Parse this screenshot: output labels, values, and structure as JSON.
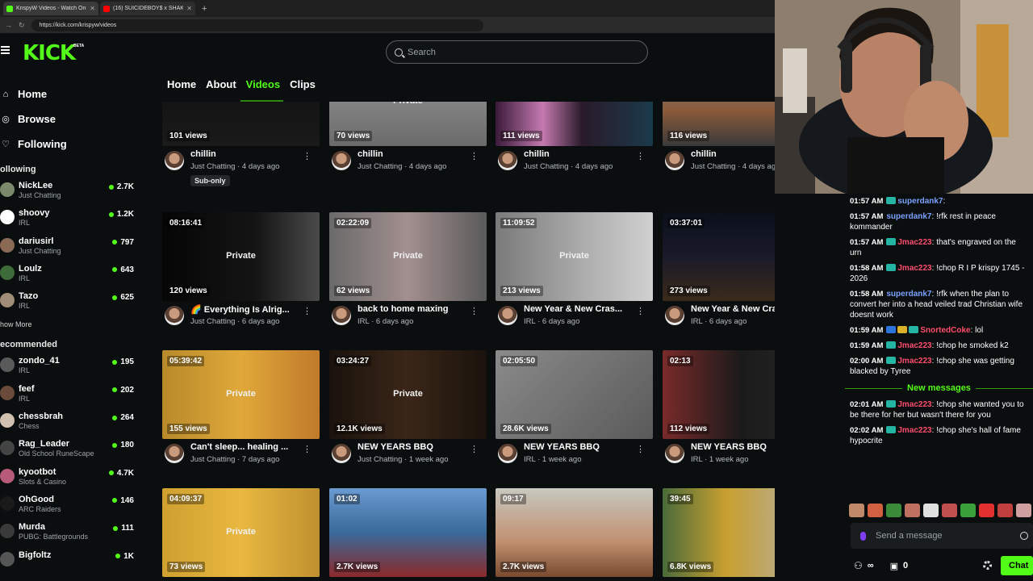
{
  "browser": {
    "tabs": [
      {
        "label": "KrispyW Videos - Watch On-Demand",
        "color": "#53fc18"
      },
      {
        "label": "(16) SUICIDEBOY$ x SHAKEWELL",
        "color": "#ff0000"
      }
    ],
    "url": "https://kick.com/krispyw/videos"
  },
  "header": {
    "logo": "KICK",
    "beta": "BETA",
    "search_placeholder": "Search"
  },
  "sidebar": {
    "nav": [
      {
        "label": "Home",
        "icon": "home-icon",
        "glyph": "⌂"
      },
      {
        "label": "Browse",
        "icon": "compass-icon",
        "glyph": "◎"
      },
      {
        "label": "Following",
        "icon": "heart-icon",
        "glyph": "♡"
      }
    ],
    "following_title": "ollowing",
    "following": [
      {
        "name": "NickLee",
        "category": "Just Chatting",
        "count": "2.7K",
        "color": "#7b8a6a"
      },
      {
        "name": "shoovy",
        "category": "IRL",
        "count": "1.2K",
        "color": "#ffffff"
      },
      {
        "name": "dariusirl",
        "category": "Just Chatting",
        "count": "797",
        "color": "#8a6a55"
      },
      {
        "name": "Loulz",
        "category": "IRL",
        "count": "643",
        "color": "#3d6b3a"
      },
      {
        "name": "Tazo",
        "category": "IRL",
        "count": "625",
        "color": "#a08d78"
      }
    ],
    "show_more": "how More",
    "recommended_title": "ecommended",
    "recommended": [
      {
        "name": "zondo_41",
        "category": "IRL",
        "count": "195",
        "color": "#5a5a5a"
      },
      {
        "name": "feef",
        "category": "IRL",
        "count": "202",
        "color": "#6a4a3a"
      },
      {
        "name": "chessbrah",
        "category": "Chess",
        "count": "264",
        "color": "#d0c0b0"
      },
      {
        "name": "Rag_Leader",
        "category": "Old School RuneScape",
        "count": "180",
        "color": "#444444"
      },
      {
        "name": "kyootbot",
        "category": "Slots & Casino",
        "count": "4.7K",
        "color": "#b85a7a"
      },
      {
        "name": "OhGood",
        "category": "ARC Raiders",
        "count": "146",
        "color": "#1a1a1a"
      },
      {
        "name": "Murda",
        "category": "PUBG: Battlegrounds",
        "count": "111",
        "color": "#3a3a3a"
      },
      {
        "name": "Bigfoltz",
        "category": "",
        "count": "1K",
        "color": "#555555"
      }
    ]
  },
  "content_tabs": [
    {
      "label": "Home",
      "active": false
    },
    {
      "label": "About",
      "active": false
    },
    {
      "label": "Videos",
      "active": true
    },
    {
      "label": "Clips",
      "active": false
    }
  ],
  "videos": [
    {
      "duration": "",
      "views": "101 views",
      "private": "",
      "title": "chillin",
      "category": "Just Chatting",
      "age": "4 days ago",
      "badge": "Sub-only",
      "bg": "linear-gradient(180deg,#0d0d0d,#1a1a1a)"
    },
    {
      "duration": "",
      "views": "70 views",
      "private": "Private",
      "title": "chillin",
      "category": "Just Chatting",
      "age": "4 days ago",
      "badge": "",
      "bg": "linear-gradient(180deg,#9a9a9a,#6b6b6b)"
    },
    {
      "duration": "",
      "views": "111 views",
      "private": "",
      "title": "chillin",
      "category": "Just Chatting",
      "age": "4 days ago",
      "badge": "",
      "bg": "linear-gradient(90deg,#3b1a3a 0%,#c47ab0 30%,#2a1a2a 55%,#1a3a4a 100%)"
    },
    {
      "duration": "",
      "views": "116 views",
      "private": "",
      "title": "chillin",
      "category": "Just Chatting",
      "age": "4 days ago",
      "badge": "",
      "bg": "linear-gradient(180deg,#6a8a9a,#8a5a3a 60%,#3a3a3a)"
    },
    {
      "duration": "08:16:41",
      "views": "120 views",
      "private": "Private",
      "title": "🌈 Everything Is Alrig...",
      "category": "Just Chatting",
      "age": "6 days ago",
      "badge": "",
      "bg": "linear-gradient(90deg,#050505 0%,#151515 60%,#4a4a4a 100%)"
    },
    {
      "duration": "02:22:09",
      "views": "62 views",
      "private": "Private",
      "title": "back to home maxing",
      "category": "IRL",
      "age": "6 days ago",
      "badge": "",
      "bg": "linear-gradient(90deg,#6a6a6a 0%,#a38f8f 50%,#5a5a5a 100%)"
    },
    {
      "duration": "11:09:52",
      "views": "213 views",
      "private": "Private",
      "title": "New Year & New Cras...",
      "category": "IRL",
      "age": "6 days ago",
      "badge": "",
      "bg": "linear-gradient(90deg,#7a7a7a 0%,#b0b0b0 60%,#d0d0d0 100%)"
    },
    {
      "duration": "03:37:01",
      "views": "273 views",
      "private": "",
      "title": "New Year & New Cras...",
      "category": "IRL",
      "age": "6 days ago",
      "badge": "",
      "bg": "linear-gradient(180deg,#0a0f1a 0%,#1a1a2a 50%,#3a2a1a 100%)"
    },
    {
      "duration": "05:39:42",
      "views": "155 views",
      "private": "Private",
      "title": "Can't sleep... healing ...",
      "category": "Just Chatting",
      "age": "7 days ago",
      "badge": "",
      "bg": "linear-gradient(90deg,#b88a2a 0%,#e0a83a 50%,#c07a2a 100%)"
    },
    {
      "duration": "03:24:27",
      "views": "12.1K views",
      "private": "Private",
      "title": "NEW YEARS BBQ",
      "category": "Just Chatting",
      "age": "1 week ago",
      "badge": "",
      "bg": "linear-gradient(90deg,#1a120c 0%,#3a2618 50%,#1a120c 100%)"
    },
    {
      "duration": "02:05:50",
      "views": "28.6K views",
      "private": "",
      "title": "NEW YEARS BBQ",
      "category": "IRL",
      "age": "1 week ago",
      "badge": "",
      "bg": "linear-gradient(135deg,#8a8a8a 0%,#5a5a5a 100%)"
    },
    {
      "duration": "02:13",
      "views": "112 views",
      "private": "",
      "title": "NEW YEARS BBQ",
      "category": "IRL",
      "age": "1 week ago",
      "badge": "",
      "bg": "linear-gradient(90deg,#7a2a2a 0%,#1a1a1a 50%,#2a2a2a 100%)"
    },
    {
      "duration": "04:09:37",
      "views": "73 views",
      "private": "Private",
      "title": "",
      "category": "",
      "age": "",
      "badge": "",
      "bg": "linear-gradient(90deg,#d0a030 0%,#e8b840 50%,#c09030 100%)"
    },
    {
      "duration": "01:02",
      "views": "2.7K views",
      "private": "",
      "title": "",
      "category": "",
      "age": "",
      "badge": "",
      "bg": "linear-gradient(180deg,#6a9ad0 0%,#3a6a9a 50%,#8a2a2a 100%)"
    },
    {
      "duration": "09:17",
      "views": "2.7K views",
      "private": "",
      "title": "",
      "category": "",
      "age": "",
      "badge": "",
      "bg": "linear-gradient(180deg,#c8c8c0 0%,#c09070 60%,#7a4a30 100%)"
    },
    {
      "duration": "39:45",
      "views": "6.8K views",
      "private": "",
      "title": "",
      "category": "",
      "age": "",
      "badge": "",
      "bg": "linear-gradient(90deg,#4a6a3a 0%,#c8a030 40%,#b0b0b0 100%)"
    }
  ],
  "chat": {
    "messages": [
      {
        "time": "01:57 AM",
        "badges": [
          "g"
        ],
        "user": "superdank7",
        "color": "#7aa2ff",
        "text": ""
      },
      {
        "time": "01:57 AM",
        "badges": [],
        "user": "superdank7",
        "color": "#7aa2ff",
        "text": "!rfk rest in peace kommander"
      },
      {
        "time": "01:57 AM",
        "badges": [
          "g"
        ],
        "user": "Jmac223",
        "color": "#ff4d6d",
        "text": "that's engraved on the urn"
      },
      {
        "time": "01:58 AM",
        "badges": [
          "g"
        ],
        "user": "Jmac223",
        "color": "#ff4d6d",
        "text": "!chop R I P krispy 1745 - 2026"
      },
      {
        "time": "01:58 AM",
        "badges": [],
        "user": "superdank7",
        "color": "#7aa2ff",
        "text": "!rfk when the plan to convert her into a head veiled trad Christian wife doesnt work"
      },
      {
        "time": "01:59 AM",
        "badges": [
          "b",
          "y",
          "g"
        ],
        "user": "SnortedCoke",
        "color": "#ff4d6d",
        "text": "lol"
      },
      {
        "time": "01:59 AM",
        "badges": [
          "g"
        ],
        "user": "Jmac223",
        "color": "#ff4d6d",
        "text": "!chop he smoked k2"
      },
      {
        "time": "02:00 AM",
        "badges": [
          "g"
        ],
        "user": "Jmac223",
        "color": "#ff4d6d",
        "text": "!chop she was getting blacked by Tyree"
      }
    ],
    "new_messages_label": "New messages",
    "new_messages": [
      {
        "time": "02:01 AM",
        "badges": [
          "g"
        ],
        "user": "Jmac223",
        "color": "#ff4d6d",
        "text": "!chop she wanted you to be there for her but wasn't there for you"
      },
      {
        "time": "02:02 AM",
        "badges": [
          "g"
        ],
        "user": "Jmac223",
        "color": "#ff4d6d",
        "text": "!chop she's hall of fame hypocrite"
      }
    ],
    "input_placeholder": "Send a message",
    "footer": {
      "infinity": "∞",
      "points": "0",
      "chat_button": "Chat"
    },
    "emote_colors": [
      "#c08a6a",
      "#d06040",
      "#3a8a3a",
      "#c07060",
      "#e0e0e0",
      "#c05050",
      "#3aa03a",
      "#e03030",
      "#c04040",
      "#d0a0a0"
    ]
  }
}
